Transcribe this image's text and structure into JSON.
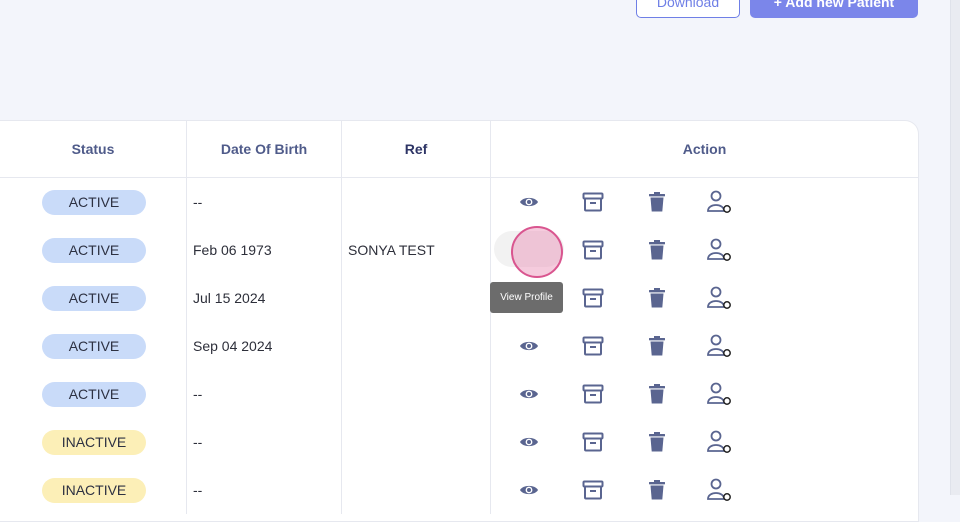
{
  "toolbar": {
    "download_label": "Download",
    "add_label": "+ Add new Patient"
  },
  "table": {
    "headers": {
      "status": "Status",
      "dob": "Date Of Birth",
      "ref": "Ref",
      "action": "Action"
    },
    "rows": [
      {
        "status": "ACTIVE",
        "dob": "--",
        "ref": ""
      },
      {
        "status": "ACTIVE",
        "dob": "Feb 06 1973",
        "ref": "SONYA TEST"
      },
      {
        "status": "ACTIVE",
        "dob": "Jul 15 2024",
        "ref": ""
      },
      {
        "status": "ACTIVE",
        "dob": "Sep 04 2024",
        "ref": ""
      },
      {
        "status": "ACTIVE",
        "dob": "--",
        "ref": ""
      },
      {
        "status": "INACTIVE",
        "dob": "--",
        "ref": ""
      },
      {
        "status": "INACTIVE",
        "dob": "--",
        "ref": ""
      }
    ]
  },
  "tooltip": "View Profile",
  "icons": {
    "view": "eye-icon",
    "archive": "archive-icon",
    "delete": "trash-icon",
    "assign": "user-assign-icon"
  },
  "colors": {
    "accent": "#7b86ea",
    "icon": "#5a6590",
    "active_badge": "#c9dbf9",
    "inactive_badge": "#fcefb7"
  }
}
